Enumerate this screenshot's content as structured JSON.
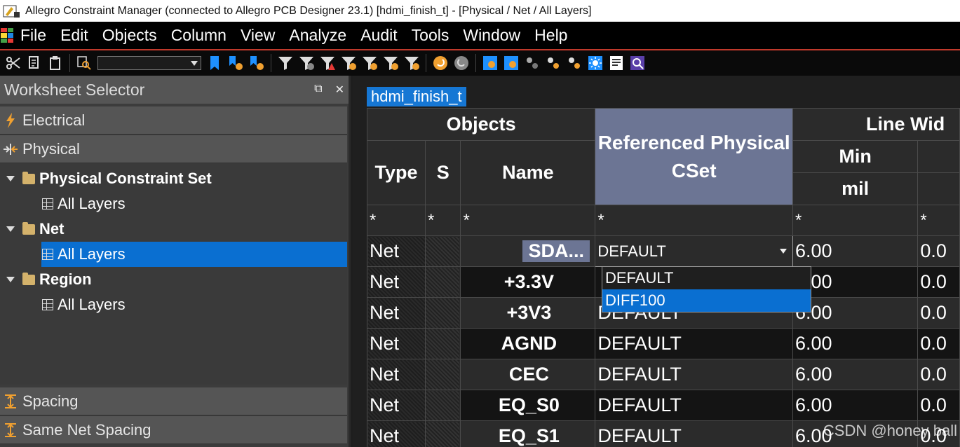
{
  "window": {
    "title": "Allegro Constraint Manager (connected to Allegro PCB Designer 23.1) [hdmi_finish_t] - [Physical / Net / All Layers]"
  },
  "menu": [
    "File",
    "Edit",
    "Objects",
    "Column",
    "View",
    "Analyze",
    "Audit",
    "Tools",
    "Window",
    "Help"
  ],
  "toolbar": {
    "icons": [
      "scissors-icon",
      "copy-icon",
      "paste-icon",
      "find-icon",
      "bookmark-icon",
      "bookmark-next-icon",
      "bookmark-prev-icon",
      "filter-icon",
      "filter-b-icon",
      "filter-error-icon",
      "filter-c-icon",
      "filter-d-icon",
      "filter-e-icon",
      "filter-f-icon",
      "undo-icon",
      "redo-icon",
      "sheet-a-icon",
      "sheet-b-icon",
      "sheet-c-icon",
      "sheet-d-icon",
      "sheet-e-icon",
      "sun-icon",
      "report-icon",
      "zoom-icon"
    ],
    "combo_value": ""
  },
  "worksheet_selector": {
    "title": "Worksheet Selector",
    "float_label": "⧉",
    "close_label": "✕",
    "sections": {
      "electrical": "Electrical",
      "physical": "Physical",
      "spacing": "Spacing",
      "same_net_spacing": "Same Net Spacing"
    },
    "tree": [
      {
        "label": "Physical Constraint Set",
        "child": "All Layers"
      },
      {
        "label": "Net",
        "child": "All Layers"
      },
      {
        "label": "Region",
        "child": "All Layers"
      }
    ]
  },
  "sheet": {
    "tab": "hdmi_finish_t",
    "headers": {
      "objects": "Objects",
      "type": "Type",
      "s": "S",
      "name": "Name",
      "ref_cset": "Referenced Physical CSet",
      "line_width": "Line Wid",
      "min": "Min",
      "unit": "mil"
    },
    "filter": [
      "*",
      "*",
      "*",
      "*",
      "*",
      "*"
    ],
    "rows": [
      {
        "type": "Net",
        "name": "SDA...",
        "cset": "DEFAULT",
        "min": "6.00",
        "max": "0.0"
      },
      {
        "type": "Net",
        "name": "+3.3V",
        "cset": "",
        "min": "6.00",
        "max": "0.0"
      },
      {
        "type": "Net",
        "name": "+3V3",
        "cset": "DEFAULT",
        "min": "6.00",
        "max": "0.0"
      },
      {
        "type": "Net",
        "name": "AGND",
        "cset": "DEFAULT",
        "min": "6.00",
        "max": "0.0"
      },
      {
        "type": "Net",
        "name": "CEC",
        "cset": "DEFAULT",
        "min": "6.00",
        "max": "0.0"
      },
      {
        "type": "Net",
        "name": "EQ_S0",
        "cset": "DEFAULT",
        "min": "6.00",
        "max": "0.0"
      },
      {
        "type": "Net",
        "name": "EQ_S1",
        "cset": "DEFAULT",
        "min": "6.00",
        "max": "0.0"
      }
    ],
    "dropdown_options": [
      "DEFAULT",
      "DIFF100"
    ],
    "dropdown_selected": "DIFF100"
  },
  "watermark": "CSDN @honey ball"
}
